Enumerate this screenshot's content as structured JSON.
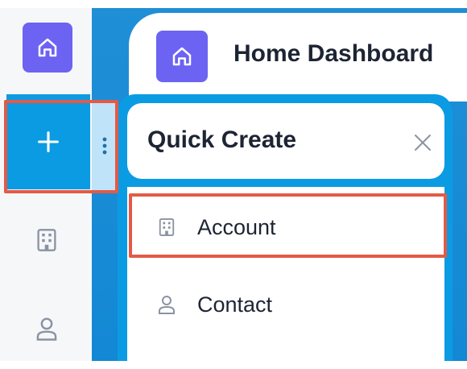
{
  "header": {
    "title": "Home Dashboard",
    "home_icon": "home-icon"
  },
  "rail": {
    "items": [
      {
        "icon": "home-icon"
      },
      {
        "icon": "plus-icon",
        "active": true
      },
      {
        "icon": "building-icon"
      },
      {
        "icon": "person-icon"
      }
    ],
    "more_icon": "more-vertical-icon"
  },
  "quick_create": {
    "title": "Quick Create",
    "close_icon": "close-icon",
    "items": [
      {
        "label": "Account",
        "icon": "building-icon",
        "highlighted": true
      },
      {
        "label": "Contact",
        "icon": "person-icon"
      }
    ]
  },
  "colors": {
    "accent_blue": "#0b9be3",
    "home_purple": "#6c63f2",
    "highlight_red": "#e35a46",
    "text_dark": "#1d2433",
    "icon_gray": "#8a93a3"
  }
}
